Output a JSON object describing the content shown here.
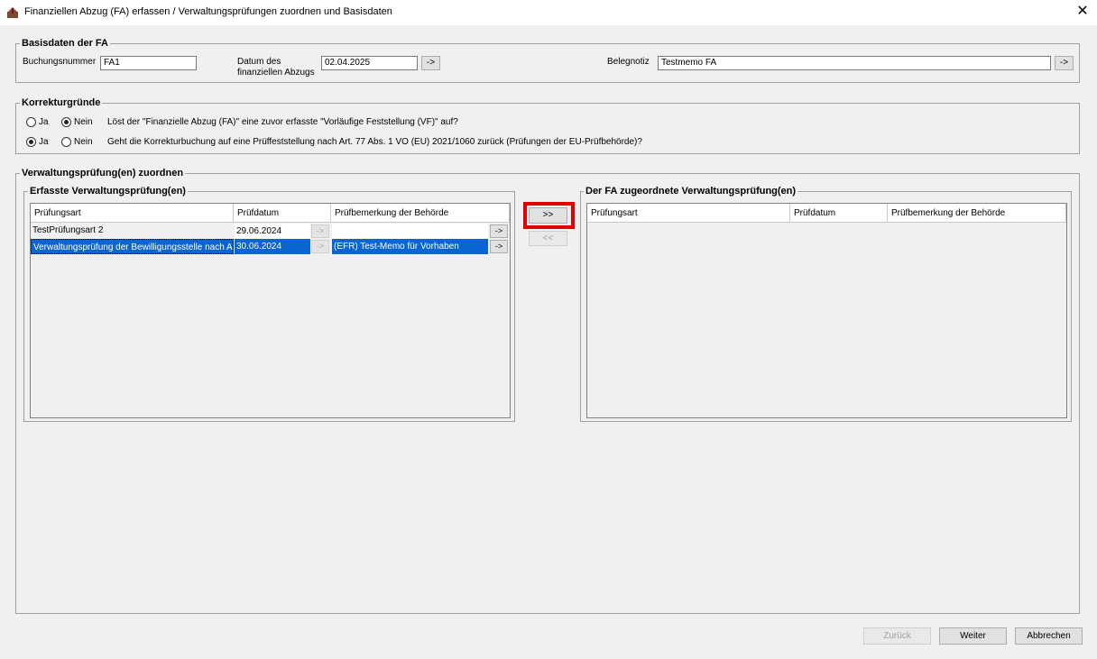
{
  "window": {
    "title": "Finanziellen Abzug (FA) erfassen / Verwaltungsprüfungen zuordnen und Basisdaten",
    "close": "✕"
  },
  "basis": {
    "legend": "Basisdaten der FA",
    "buchungsnummer_label": "Buchungsnummer",
    "buchungsnummer_value": "FA1",
    "datum_label_1": "Datum des",
    "datum_label_2": "finanziellen Abzugs",
    "datum_value": "02.04.2025",
    "datum_btn": "->",
    "belegnotiz_label": "Belegnotiz",
    "belegnotiz_value": "Testmemo FA",
    "belegnotiz_btn": "->"
  },
  "korrektur": {
    "legend": "Korrekturgründe",
    "ja": "Ja",
    "nein": "Nein",
    "q1": "Löst der \"Finanzielle Abzug (FA)\" eine zuvor erfasste \"Vorläufige Feststellung (VF)\" auf?",
    "q2": "Geht die Korrekturbuchung auf eine Prüffeststellung nach Art. 77 Abs. 1 VO (EU) 2021/1060 zurück (Prüfungen der EU-Prüfbehörde)?"
  },
  "zuordnen": {
    "legend": "Verwaltungsprüfung(en) zuordnen",
    "left_legend": "Erfasste Verwaltungsprüfung(en)",
    "right_legend": "Der FA zugeordnete Verwaltungsprüfung(en)",
    "columns": [
      "Prüfungsart",
      "Prüfdatum",
      "Prüfbemerkung der Behörde"
    ],
    "rows": [
      {
        "art": "TestPrüfungsart 2",
        "datum": "29.06.2024",
        "bemerkung": "",
        "btn": "->"
      },
      {
        "art": "Verwaltungsprüfung der Bewilligungsstelle nach Art",
        "datum": "30.06.2024",
        "bemerkung": "(EFR) Test-Memo für Vorhaben",
        "btn": "->"
      }
    ],
    "move_right": ">>",
    "move_left": "<<"
  },
  "footer": {
    "zurueck": "Zurück",
    "weiter": "Weiter",
    "abbrechen": "Abbrechen"
  },
  "colors": {
    "selection": "#0a64d2",
    "highlight": "#e00000"
  }
}
